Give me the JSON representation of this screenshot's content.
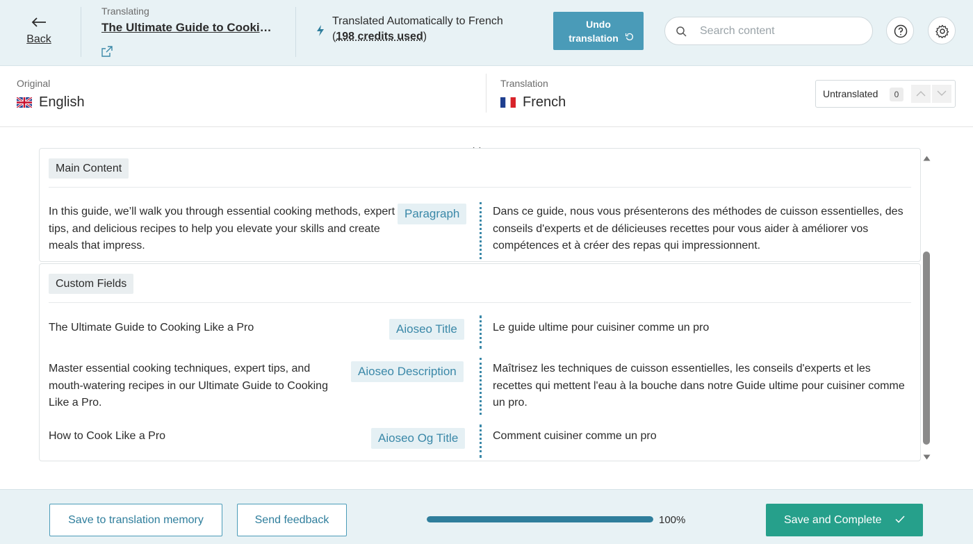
{
  "header": {
    "back_label": "Back",
    "translating_label": "Translating",
    "post_title": "The Ultimate Guide to Cooking Like a Pro",
    "auto_line1": "Translated Automatically to French",
    "auto_open": "(",
    "credits_used": "198 credits used",
    "auto_close": ")",
    "undo_line1": "Undo",
    "undo_line2": "translation",
    "search_placeholder": "Search content",
    "search_value": ""
  },
  "languages": {
    "original_label": "Original",
    "original_name": "English",
    "translation_label": "Translation",
    "translation_name": "French",
    "untranslated_label": "Untranslated",
    "untranslated_count": "0"
  },
  "sections": {
    "main": {
      "title": "Main Content",
      "rows": [
        {
          "original": "In this guide, we’ll walk you through essential cooking methods, expert tips, and delicious recipes to help you elevate your skills and create meals that impress.",
          "type": "Paragraph",
          "translation": "Dans ce guide, nous vous présenterons des méthodes de cuisson essentielles, des conseils d'experts et de délicieuses recettes pour vous aider à améliorer vos compétences et à créer des repas qui impressionnent."
        }
      ]
    },
    "custom": {
      "title": "Custom Fields",
      "rows": [
        {
          "original": "The Ultimate Guide to Cooking Like a Pro",
          "type": "Aioseo Title",
          "translation": "Le guide ultime pour cuisiner comme un pro"
        },
        {
          "original": "Master essential cooking techniques, expert tips, and mouth-watering recipes in our Ultimate Guide to Cooking Like a Pro.",
          "type": "Aioseo Description",
          "translation": "Maîtrisez les techniques de cuisson essentielles, les conseils d'experts et les recettes qui mettent l'eau à la bouche dans notre Guide ultime pour cuisiner comme un pro."
        },
        {
          "original": "How to Cook Like a Pro",
          "type": "Aioseo Og Title",
          "translation": "Comment cuisiner comme un pro"
        }
      ]
    }
  },
  "footer": {
    "save_memory_label": "Save to translation memory",
    "feedback_label": "Send feedback",
    "progress_fraction": 1.0,
    "progress_text": "100%",
    "save_complete_label": "Save and Complete"
  },
  "colors": {
    "accent": "#4a9bb8",
    "accent_dark": "#2f7e9c",
    "success": "#26a08b",
    "topbar_bg": "#e8f2f5"
  },
  "icons": [
    "arrow-left-icon",
    "external-link-icon",
    "lightning-icon",
    "undo-icon",
    "search-icon",
    "help-icon",
    "gear-icon",
    "uk-flag-icon",
    "france-flag-icon",
    "chevron-up-icon",
    "chevron-down-icon",
    "check-icon"
  ]
}
